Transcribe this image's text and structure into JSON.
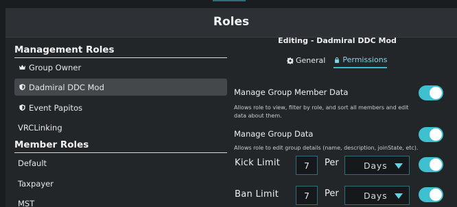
{
  "page": {
    "title": "Roles"
  },
  "left": {
    "management_heading": "Management Roles",
    "management_roles": [
      {
        "label": "Group Owner",
        "icon": "crown-icon",
        "selected": false
      },
      {
        "label": "Dadmiral DDC Mod",
        "icon": "shield-icon",
        "selected": true
      },
      {
        "label": "Event Papitos",
        "icon": "shield-icon",
        "selected": false
      },
      {
        "label": "VRCLinking",
        "icon": "",
        "selected": false
      }
    ],
    "member_heading": "Member Roles",
    "member_roles": [
      {
        "label": "Default"
      },
      {
        "label": "Taxpayer"
      },
      {
        "label": "MST"
      }
    ]
  },
  "editor": {
    "editing_title": "Editing - Dadmiral DDC Mod",
    "tabs": [
      {
        "label": "General",
        "icon": "gear-icon",
        "active": false
      },
      {
        "label": "Permissions",
        "icon": "lock-icon",
        "active": true
      }
    ],
    "permissions": [
      {
        "title": "Manage Group Member Data",
        "description": "Allows role to view, filter by role, and sort all members and edit data about them.",
        "enabled": true
      },
      {
        "title": "Manage Group Data",
        "description": "Allows role to edit group details (name, description, joinState, etc).",
        "enabled": true
      }
    ],
    "limits": [
      {
        "label": "Kick Limit",
        "value": "7",
        "per_label": "Per",
        "unit": "Days",
        "enabled": true
      },
      {
        "label": "Ban Limit",
        "value": "7",
        "per_label": "Per",
        "unit": "Days",
        "enabled": true
      }
    ]
  },
  "colors": {
    "accent": "#3fc0d0",
    "selected_row": "#43484d",
    "panel": "#232629"
  }
}
